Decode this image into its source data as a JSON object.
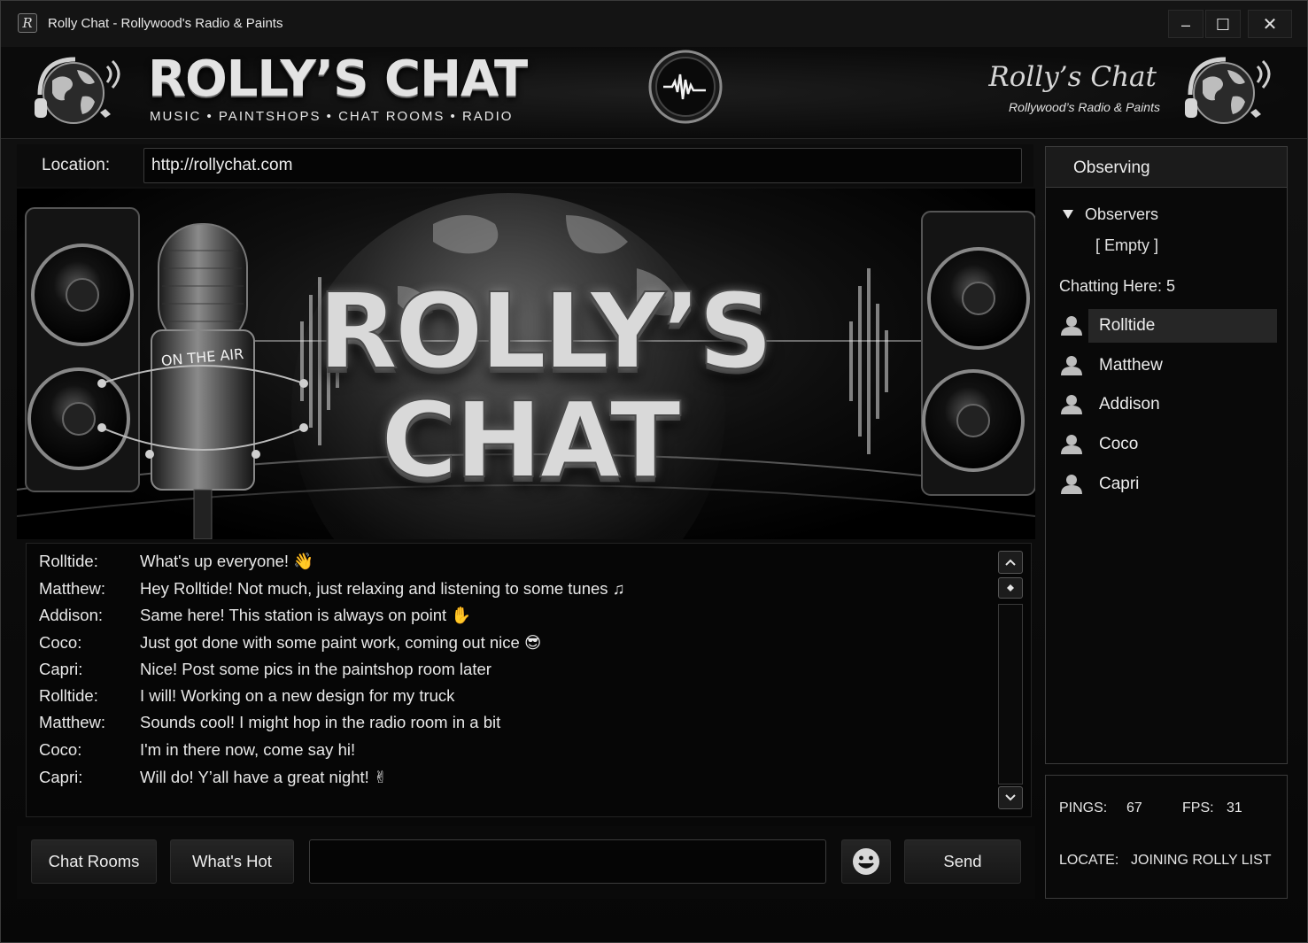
{
  "window": {
    "title": "Rolly Chat - Rollywood's Radio & Paints",
    "icon_letter": "R",
    "controls": {
      "minimize": "–",
      "maximize": "☐",
      "close": "✕"
    }
  },
  "header": {
    "brand_title": "ROLLY’S CHAT",
    "tagline": "MUSIC • PAINTSHOPS • CHAT ROOMS • RADIO",
    "right_title": "Rolly’s Chat",
    "right_subtitle": "Rollywood’s Radio & Paints",
    "icons": [
      "globe-headphones-icon",
      "waveform-badge-icon"
    ]
  },
  "location": {
    "label": "Location:",
    "url": "http://rollychat.com"
  },
  "banner": {
    "line1": "ROLLY’S",
    "line2": "CHAT",
    "mic_label": "ON THE AIR"
  },
  "chat": {
    "messages": [
      {
        "user": "Rolltide:",
        "text": "What's up everyone! 👋"
      },
      {
        "user": "Matthew:",
        "text": "Hey Rolltide! Not much, just relaxing and listening to some tunes ♫"
      },
      {
        "user": "Addison:",
        "text": "Same here! This station is always on point ✋"
      },
      {
        "user": "Coco:",
        "text": "Just got done with some paint work, coming out nice 😎"
      },
      {
        "user": "Capri:",
        "text": "Nice! Post some pics in the paintshop room later"
      },
      {
        "user": "Rolltide:",
        "text": "I will! Working on a new design for my truck"
      },
      {
        "user": "Matthew:",
        "text": "Sounds cool! I might hop in the radio room in a bit"
      },
      {
        "user": "Coco:",
        "text": "I'm in there now, come say hi!"
      },
      {
        "user": "Capri:",
        "text": "Will do! Y’all have a great night! ✌"
      }
    ]
  },
  "input_bar": {
    "chat_rooms": "Chat Rooms",
    "whats_hot": "What's Hot",
    "message_value": "",
    "send": "Send"
  },
  "sidebar": {
    "title": "Observing",
    "observers_label": "Observers",
    "observers_empty": "[ Empty ]",
    "chatting_here": "Chatting Here: 5",
    "users": [
      "Rolltide",
      "Matthew",
      "Addison",
      "Coco",
      "Capri"
    ],
    "selected_user": "Rolltide"
  },
  "stats": {
    "pings_label": "PINGS:",
    "pings_value": "67",
    "fps_label": "FPS:",
    "fps_value": "31",
    "locate_label": "LOCATE:",
    "locate_value": "JOINING ROLLY LIST"
  },
  "colors": {
    "background": "#0b0b0b",
    "panel_border": "#3b3b3b",
    "text": "#e8e8e8",
    "selected_row": "#262626"
  }
}
